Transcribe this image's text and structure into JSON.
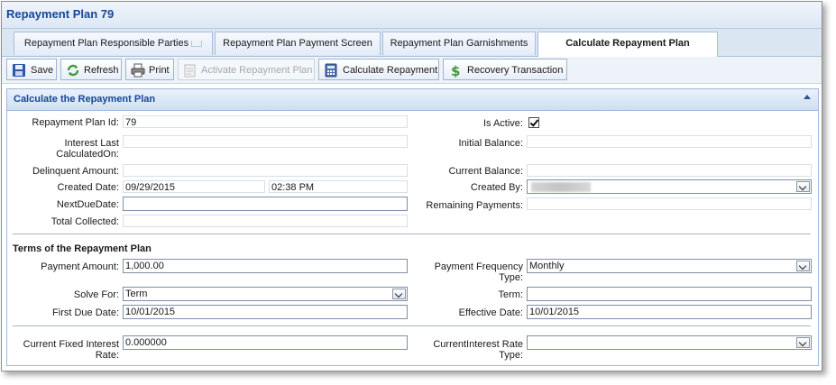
{
  "window": {
    "title": "Repayment Plan 79"
  },
  "tabs": [
    {
      "label": "Repayment Plan Responsible Parties"
    },
    {
      "label": "Repayment Plan Payment Screen"
    },
    {
      "label": "Repayment Plan Garnishments"
    },
    {
      "label": "Calculate Repayment Plan",
      "active": true
    }
  ],
  "toolbar": {
    "save": "Save",
    "refresh": "Refresh",
    "print": "Print",
    "activate": "Activate Repayment Plan",
    "calculate": "Calculate Repayment",
    "recovery": "Recovery Transaction"
  },
  "panel": {
    "title": "Calculate the Repayment Plan"
  },
  "fields": {
    "plan_id_label": "Repayment Plan Id:",
    "plan_id_value": "79",
    "interest_last_label": "Interest Last CalculatedOn:",
    "interest_last_value": "",
    "delinquent_label": "Delinquent Amount:",
    "delinquent_value": "",
    "created_date_label": "Created Date:",
    "created_date_value": "09/29/2015",
    "created_time_value": "02:38 PM",
    "next_due_label": "NextDueDate:",
    "next_due_value": "",
    "total_collected_label": "Total Collected:",
    "total_collected_value": "",
    "is_active_label": "Is Active:",
    "is_active_checked": true,
    "initial_balance_label": "Initial Balance:",
    "initial_balance_value": "",
    "current_balance_label": "Current Balance:",
    "current_balance_value": "",
    "created_by_label": "Created By:",
    "remaining_payments_label": "Remaining Payments:",
    "remaining_payments_value": ""
  },
  "terms": {
    "section_title": "Terms of the Repayment Plan",
    "payment_amount_label": "Payment Amount:",
    "payment_amount_value": "1,000.00",
    "solve_for_label": "Solve For:",
    "solve_for_value": "Term",
    "first_due_label": "First Due Date:",
    "first_due_value": "10/01/2015",
    "frequency_label": "Payment Frequency Type:",
    "frequency_value": "Monthly",
    "term_label": "Term:",
    "term_value": "",
    "effective_date_label": "Effective Date:",
    "effective_date_value": "10/01/2015",
    "fixed_rate_label": "Current Fixed Interest Rate:",
    "fixed_rate_value": "0.000000",
    "rate_type_label": "CurrentInterest Rate Type:",
    "rate_type_value": ""
  },
  "colors": {
    "title_blue": "#16459b",
    "panel_border": "#9fb9d9"
  }
}
